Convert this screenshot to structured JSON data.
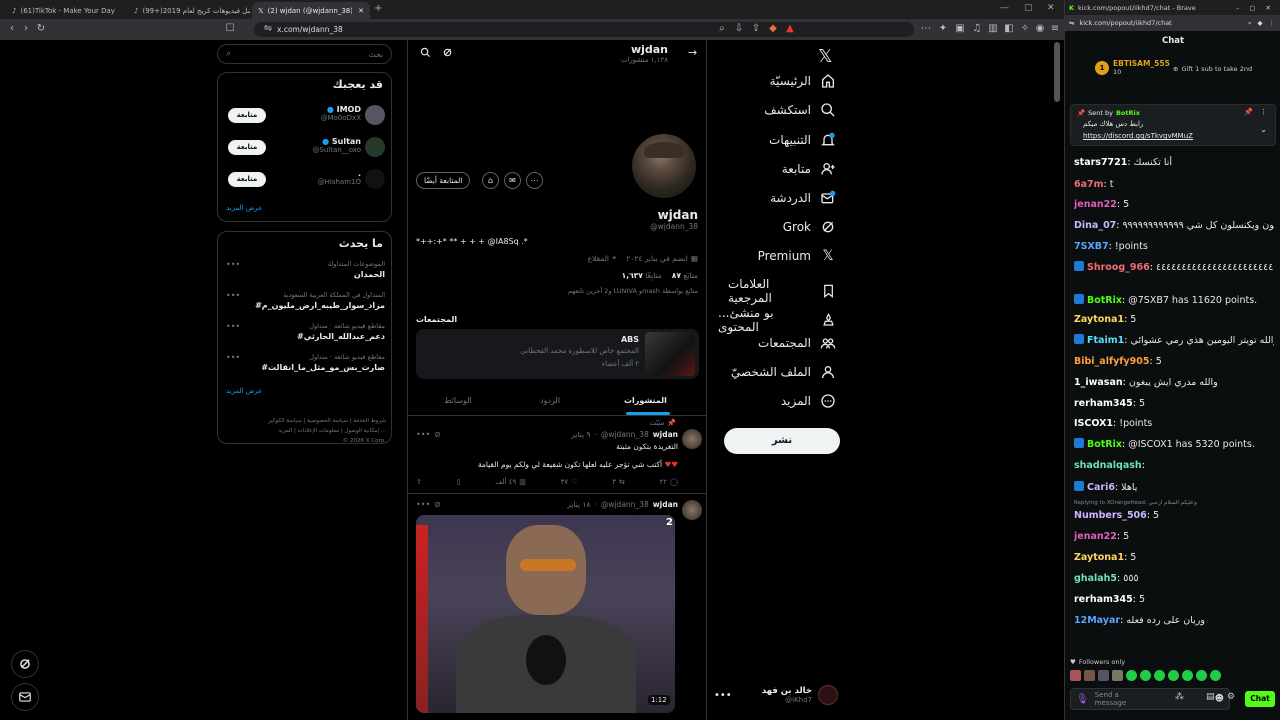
{
  "browser": {
    "tabs": [
      {
        "label": "(61)TikTok - Make Your Day"
      },
      {
        "label": "(99+)أفضل فيديوهات كريج لعام 2019"
      },
      {
        "label": "(2) wjdan (@wjdann_38) / X"
      }
    ],
    "url": "x.com/wjdann_38"
  },
  "x_nav": {
    "items": [
      {
        "label": "الرئيسيّة",
        "icon": "home-icon"
      },
      {
        "label": "استكشف",
        "icon": "search-icon"
      },
      {
        "label": "التنبيهات",
        "icon": "bell-icon"
      },
      {
        "label": "متابعة",
        "icon": "follow-icon"
      },
      {
        "label": "الدردشة",
        "icon": "chat-icon"
      },
      {
        "label": "Grok",
        "icon": "grok-icon"
      },
      {
        "label": "Premium",
        "icon": "x-logo-icon"
      },
      {
        "label": "العلامات المرجعية",
        "icon": "bookmark-icon"
      },
      {
        "label": "...بو منشئ المحتوى",
        "icon": "creator-icon"
      },
      {
        "label": "المجتمعات",
        "icon": "communities-icon"
      },
      {
        "label": "الملف الشخصيّ",
        "icon": "profile-icon"
      },
      {
        "label": "المزيد",
        "icon": "more-icon"
      }
    ],
    "post_label": "نشر",
    "account_name": "خالد بن فهد",
    "account_handle": "@iKhd7"
  },
  "profile": {
    "header_name": "wjdan",
    "header_posts": "١,١٢٨ منشورات",
    "name": "wjdan",
    "handle": "@wjdann_38",
    "bio": "*++:+* ** + + + @IA8Sq .*",
    "location": "المقلاع",
    "joined": "انضم في يناير ٢٠٢٤",
    "following_count": "٨٧",
    "following_label": "متابَع",
    "followers_count": "١,٦٣٧",
    "followers_label": "متابِعًا",
    "followed_by": "و2 آخرين تابعهم LUNIVA وmash متابَع بواسطة",
    "follow_back_label": "المتابعة أيضًا",
    "communities_title": "المجتمعات",
    "community": {
      "name": "ABS",
      "desc": "المجتمع خاص للاسطورة محمد القحطاني",
      "members": "٢ ألف أعضاء"
    },
    "tabs": [
      "المنشورات",
      "الردود",
      "الوسائط"
    ]
  },
  "posts": [
    {
      "pinned": "مثبّت",
      "name": "wjdan",
      "handle": "@wjdann_38",
      "date": "٩ يناير",
      "line1": "التغريدة بتكون مثبتة",
      "line2": "أكتب شي تؤجر عليه لعلها تكون شفيعة لي ولكم يوم القيامة",
      "replies": "٢٢",
      "reposts": "٣",
      "likes": "٣٧",
      "views": "٤٩ ألف"
    },
    {
      "name": "wjdan",
      "handle": "@wjdann_38",
      "date": "١٨ يناير",
      "media_count": "2",
      "duration": "1:12"
    }
  ],
  "search": {
    "placeholder": "بحث"
  },
  "who_to_follow": {
    "title": "قد يعجبك",
    "users": [
      {
        "name": "IMOD",
        "handle": "@Mo0oDxX",
        "btn": "متابعة"
      },
      {
        "name": "Sultan",
        "handle": "@Sultan__oxo",
        "btn": "متابعة"
      },
      {
        "name": ".",
        "handle": "@Hisham1O",
        "btn": "متابعة"
      }
    ],
    "show_more": "عرض المزيد"
  },
  "trending": {
    "title": "ما يحدث",
    "items": [
      {
        "context": "الموضوعات المتداولة",
        "topic": "الحمدان"
      },
      {
        "context": "المتداول في المملكة العربية السعودية",
        "topic": "#مزاد_سوار_طيبه_ارض_مليون_م"
      },
      {
        "context": "مقاطع فيديو شائعة · متداول",
        "topic": "#دعم_عبدالله_الحارثي"
      },
      {
        "context": "مقاطع فيديو شائعة · متداول",
        "topic": "#صارت_بس_مو_مثل_ما_انقالت"
      }
    ],
    "show_more": "عرض المزيد"
  },
  "footer": {
    "line1": "شروط الخدمة | سياسة الخصوصية | سياسة الكوكيز",
    "line2": "إمكانية الوصول | معلومات الإعلانات | المزيد ...",
    "line3": "© 2026 X Corp."
  },
  "chat": {
    "window_title": "kick.com/popout/iikhd7/chat - Brave",
    "url": "kick.com/popout/iikhd7/chat",
    "header": "Chat",
    "gifter_name": "EBTISAM_555",
    "gifter_count": "10",
    "gift_label": "Gift 1 sub to take 2nd",
    "pinned_sender_label": "Sent by",
    "pinned_sender": "BotRix",
    "pinned_text": "رابط دس هلاك ميكم",
    "pinned_link": "https://discord.gg/sTkvgvMMuZ",
    "reply_context": "Replying to XOrangeHead: وعليكم السلام ارحبي",
    "followers_only": "Followers only",
    "input_placeholder": "Send a message",
    "send_label": "Chat",
    "messages": [
      {
        "user": "stars7721",
        "color": "#ffffff",
        "text": "أنا تكنسك"
      },
      {
        "user": "6a7m",
        "color": "#f26d6d",
        "text": "t"
      },
      {
        "user": "jenan22",
        "color": "#e05dbd",
        "text": "5"
      },
      {
        "user": "Dina_07",
        "color": "#c9b6ff",
        "text": "يشون ويكنسلون كل شي ٩٩٩٩٩٩٩٩٩٩٩٩"
      },
      {
        "user": "7SXB7",
        "color": "#5aa5ff",
        "text": "!points"
      },
      {
        "user": "Shroog_966",
        "color": "#f26d6d",
        "text": "ابيوا ٤٤٤٤٤٤٤٤٤٤٤٤٤٤٤٤٤٤٤٤٤٤٤٤٤٤٤٤٤٤٤٤٤٤٤٤٤٤٤٤٤٤٤٤٤٤"
      },
      {
        "user": "BotRix",
        "color": "#53fc18",
        "text": "@7SXB7 has 11620 points."
      },
      {
        "user": "Zaytona1",
        "color": "#ffd75e",
        "text": "5"
      },
      {
        "user": "Ftaim1",
        "color": "#5ae0ff",
        "text": "والله تويتر اليومين هذي رمي عشوائي"
      },
      {
        "user": "Bibi_alfyfy905",
        "color": "#ff9e3d",
        "text": "5"
      },
      {
        "user": "1_iwasan",
        "color": "#ffffff",
        "text": "والله مدري ايش يبغون"
      },
      {
        "user": "rerham345",
        "color": "#ffffff",
        "text": "5"
      },
      {
        "user": "ISCOX1",
        "color": "#ffffff",
        "text": "!points"
      },
      {
        "user": "BotRix",
        "color": "#53fc18",
        "text": "@ISCOX1 has 5320 points."
      },
      {
        "user": "shadnalqash",
        "color": "#6fe3b4",
        "text": ""
      },
      {
        "user": "Cari6",
        "color": "#c9b6ff",
        "text": "ياهلا"
      },
      {
        "user": "Numbers_506",
        "color": "#c9b6ff",
        "text": "5"
      },
      {
        "user": "jenan22",
        "color": "#e05dbd",
        "text": "5"
      },
      {
        "user": "Zaytona1",
        "color": "#ffd75e",
        "text": "5"
      },
      {
        "user": "ghalah5",
        "color": "#6fe3b4",
        "text": "٥٥٥"
      },
      {
        "user": "rerham345",
        "color": "#ffffff",
        "text": "5"
      },
      {
        "user": "12Mayar",
        "color": "#5aa5ff",
        "text": "وريان على رده فعله"
      }
    ]
  },
  "colors": {
    "x_blue": "#1d9bf0",
    "kick_green": "#53fc18"
  }
}
